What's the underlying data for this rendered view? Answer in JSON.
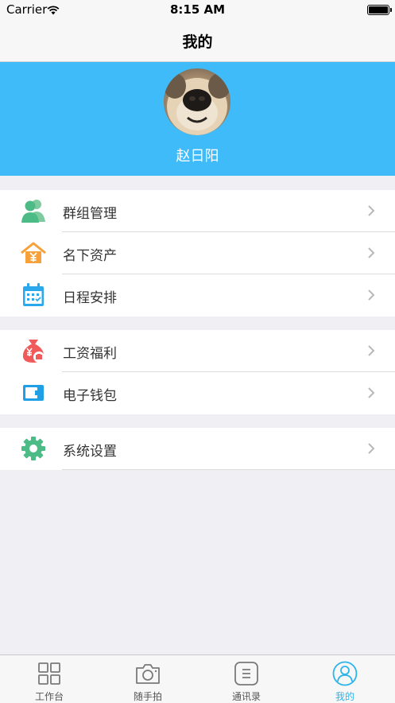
{
  "status_bar": {
    "carrier": "Carrier",
    "time": "8:15 AM"
  },
  "nav": {
    "title": "我的"
  },
  "profile": {
    "name": "赵日阳"
  },
  "groups": [
    {
      "items": [
        {
          "label": "群组管理",
          "icon": "group-icon"
        },
        {
          "label": "名下资产",
          "icon": "house-asset-icon"
        },
        {
          "label": "日程安排",
          "icon": "calendar-icon"
        }
      ]
    },
    {
      "items": [
        {
          "label": "工资福利",
          "icon": "money-bag-icon"
        },
        {
          "label": "电子钱包",
          "icon": "wallet-icon"
        }
      ]
    },
    {
      "items": [
        {
          "label": "系统设置",
          "icon": "gear-icon"
        }
      ]
    }
  ],
  "tabs": [
    {
      "label": "工作台",
      "icon": "grid-icon",
      "active": false
    },
    {
      "label": "随手拍",
      "icon": "camera-icon",
      "active": false
    },
    {
      "label": "通讯录",
      "icon": "contacts-list-icon",
      "active": false
    },
    {
      "label": "我的",
      "icon": "user-icon",
      "active": true
    }
  ],
  "colors": {
    "accent": "#40bbf9",
    "tab_active": "#2db4ea",
    "background": "#efeff4"
  }
}
